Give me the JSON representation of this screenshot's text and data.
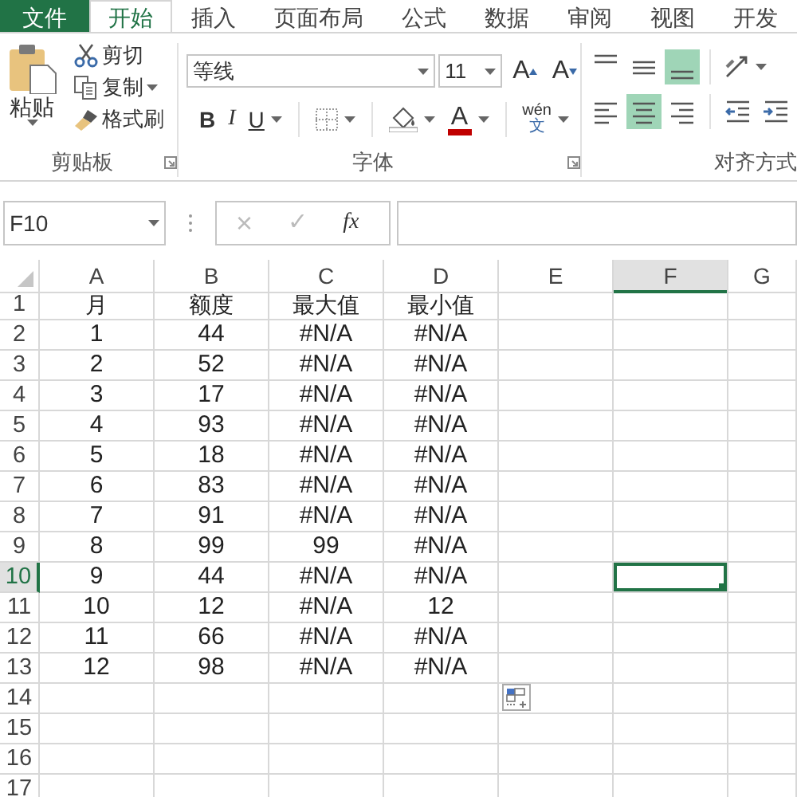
{
  "ribbon_tabs": [
    {
      "label": "文件",
      "kind": "file",
      "selected": false
    },
    {
      "label": "开始",
      "kind": "tab",
      "selected": true
    },
    {
      "label": "插入",
      "kind": "tab",
      "selected": false
    },
    {
      "label": "页面布局",
      "kind": "tab",
      "selected": false
    },
    {
      "label": "公式",
      "kind": "tab",
      "selected": false
    },
    {
      "label": "数据",
      "kind": "tab",
      "selected": false
    },
    {
      "label": "审阅",
      "kind": "tab",
      "selected": false
    },
    {
      "label": "视图",
      "kind": "tab",
      "selected": false
    },
    {
      "label": "开发",
      "kind": "tab",
      "selected": false
    }
  ],
  "clipboard": {
    "label": "剪贴板",
    "paste": {
      "label": "粘贴"
    },
    "items": [
      {
        "kind": "cut",
        "label": "剪切",
        "dropdown": false
      },
      {
        "kind": "copy",
        "label": "复制",
        "dropdown": true
      },
      {
        "kind": "painter",
        "label": "格式刷",
        "dropdown": false
      }
    ]
  },
  "font": {
    "label": "字体",
    "name": "等线",
    "size": "11",
    "size_buttons": [
      {
        "kind": "grow",
        "label": "A"
      },
      {
        "kind": "shrink",
        "label": "A"
      }
    ],
    "buttons": [
      {
        "kind": "bold",
        "label": "B",
        "dropdown": false
      },
      {
        "kind": "italic",
        "label": "I",
        "dropdown": false
      },
      {
        "kind": "underline",
        "label": "U",
        "dropdown": true
      },
      {
        "kind": "borders",
        "dropdown": true
      },
      {
        "kind": "fill",
        "dropdown": true
      },
      {
        "kind": "color",
        "label": "A",
        "dropdown": true
      },
      {
        "kind": "phonetic",
        "label": "wén",
        "sub": "文",
        "dropdown": true
      }
    ]
  },
  "alignment": {
    "label": "对齐方式",
    "rows": [
      [
        {
          "kind": "top",
          "selected": false
        },
        {
          "kind": "middle",
          "selected": false
        },
        {
          "kind": "bottom",
          "selected": true
        },
        {
          "kind": "orientation",
          "selected": false
        }
      ],
      [
        {
          "kind": "left",
          "selected": false
        },
        {
          "kind": "center",
          "selected": true
        },
        {
          "kind": "right",
          "selected": false
        },
        {
          "kind": "outdent",
          "selected": false
        },
        {
          "kind": "indent",
          "selected": false
        }
      ]
    ]
  },
  "formula_bar": {
    "name_box": "F10",
    "cancel": "×",
    "enter": "✓",
    "function": "fx"
  },
  "columns": [
    {
      "label": "A",
      "selected": false
    },
    {
      "label": "B",
      "selected": false
    },
    {
      "label": "C",
      "selected": false
    },
    {
      "label": "D",
      "selected": false
    },
    {
      "label": "E",
      "selected": false
    },
    {
      "label": "F",
      "selected": true
    },
    {
      "label": "G",
      "selected": false
    }
  ],
  "rows": [
    {
      "number": "1",
      "selected": false,
      "cells": [
        "月",
        "额度",
        "最大值",
        "最小值"
      ]
    },
    {
      "number": "2",
      "selected": false,
      "cells": [
        "1",
        "44",
        "#N/A",
        "#N/A"
      ]
    },
    {
      "number": "3",
      "selected": false,
      "cells": [
        "2",
        "52",
        "#N/A",
        "#N/A"
      ]
    },
    {
      "number": "4",
      "selected": false,
      "cells": [
        "3",
        "17",
        "#N/A",
        "#N/A"
      ]
    },
    {
      "number": "5",
      "selected": false,
      "cells": [
        "4",
        "93",
        "#N/A",
        "#N/A"
      ]
    },
    {
      "number": "6",
      "selected": false,
      "cells": [
        "5",
        "18",
        "#N/A",
        "#N/A"
      ]
    },
    {
      "number": "7",
      "selected": false,
      "cells": [
        "6",
        "83",
        "#N/A",
        "#N/A"
      ]
    },
    {
      "number": "8",
      "selected": false,
      "cells": [
        "7",
        "91",
        "#N/A",
        "#N/A"
      ]
    },
    {
      "number": "9",
      "selected": false,
      "cells": [
        "8",
        "99",
        "99",
        "#N/A"
      ]
    },
    {
      "number": "10",
      "selected": true,
      "cells": [
        "9",
        "44",
        "#N/A",
        "#N/A"
      ]
    },
    {
      "number": "11",
      "selected": false,
      "cells": [
        "10",
        "12",
        "#N/A",
        "12"
      ]
    },
    {
      "number": "12",
      "selected": false,
      "cells": [
        "11",
        "66",
        "#N/A",
        "#N/A"
      ]
    },
    {
      "number": "13",
      "selected": false,
      "cells": [
        "12",
        "98",
        "#N/A",
        "#N/A"
      ]
    },
    {
      "number": "14",
      "selected": false
    },
    {
      "number": "15",
      "selected": false
    },
    {
      "number": "16",
      "selected": false
    },
    {
      "number": "17",
      "selected": false
    }
  ]
}
